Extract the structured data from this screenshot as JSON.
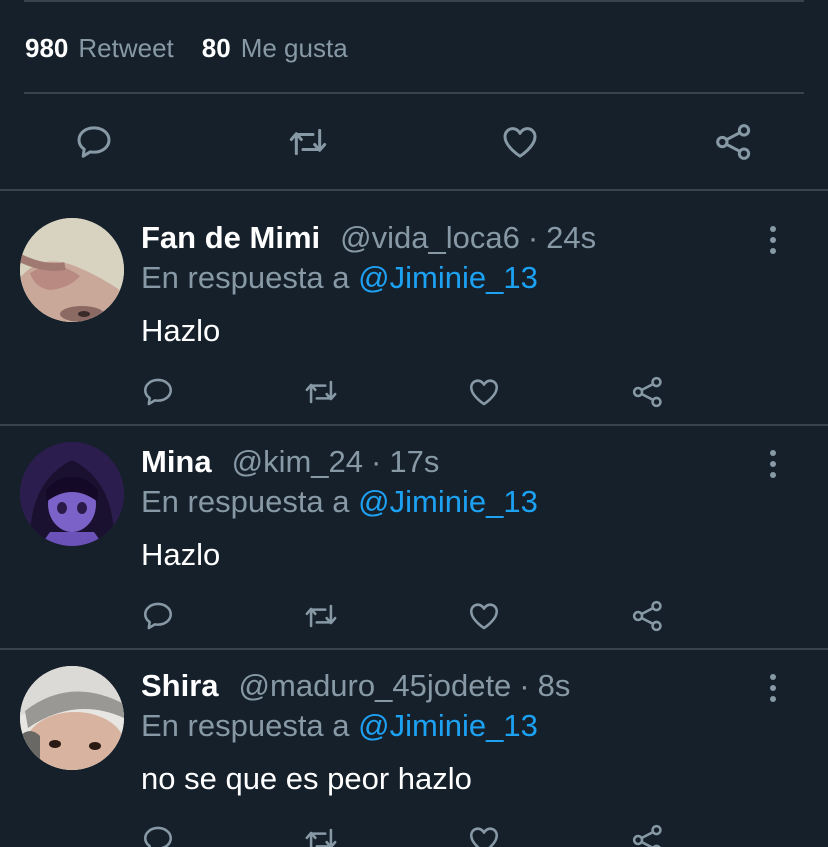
{
  "stats": {
    "retweets_count": "980",
    "retweets_label": "Retweet",
    "likes_count": "80",
    "likes_label": "Me gusta"
  },
  "colors": {
    "background": "#15202b",
    "divider": "#38444d",
    "secondary_text": "#8899a6",
    "mention": "#1da1f2"
  },
  "icons": [
    "reply-icon",
    "retweet-icon",
    "like-icon",
    "share-icon",
    "more-icon"
  ],
  "replies": [
    {
      "name": "Fan de Mimi",
      "handle": "@vida_loca6",
      "separator": "·",
      "time": "24s",
      "in_reply_prefix": "En respuesta a",
      "in_reply_to": "@Jiminie_13",
      "text": "Hazlo"
    },
    {
      "name": "Mina",
      "handle": "@kim_24",
      "separator": "·",
      "time": "17s",
      "in_reply_prefix": "En respuesta a",
      "in_reply_to": "@Jiminie_13",
      "text": "Hazlo"
    },
    {
      "name": "Shira",
      "handle": "@maduro_45jodete",
      "separator": "·",
      "time": "8s",
      "in_reply_prefix": "En respuesta a",
      "in_reply_to": "@Jiminie_13",
      "text": "no se que es peor hazlo"
    }
  ]
}
